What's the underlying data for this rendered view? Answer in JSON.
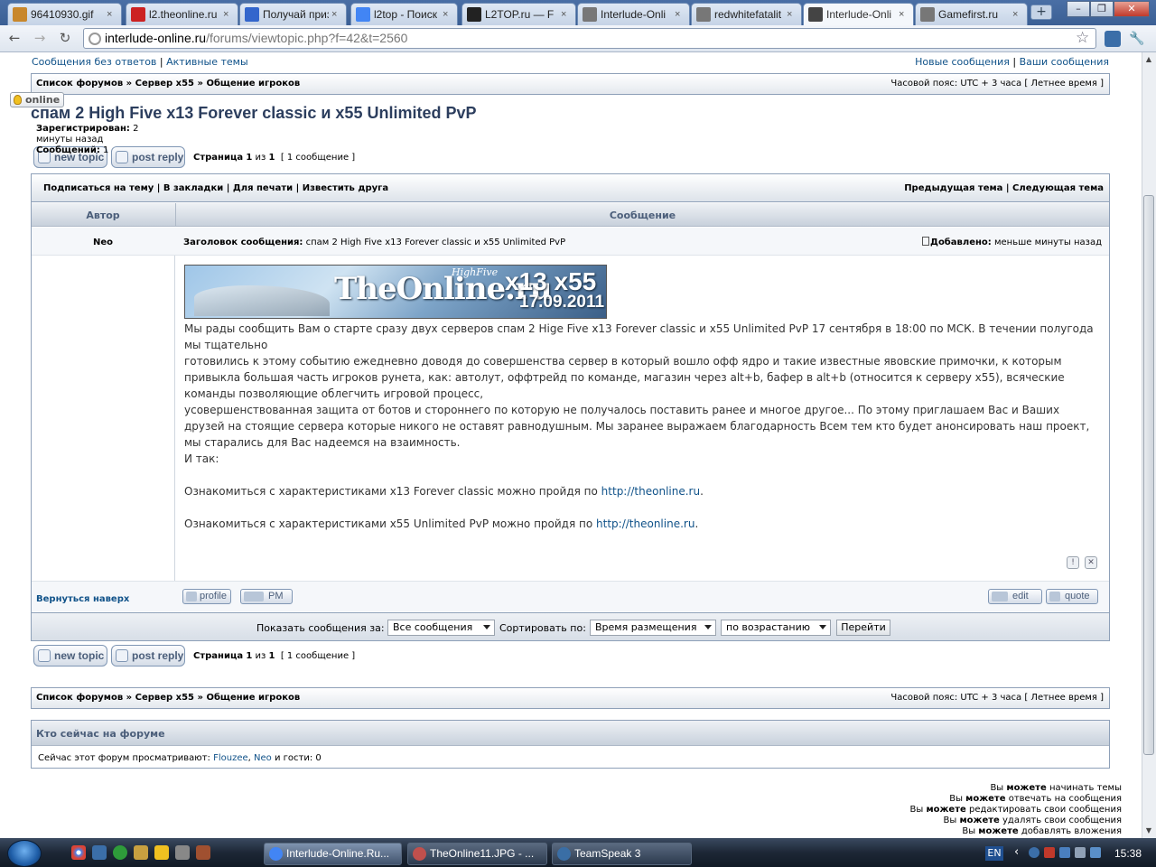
{
  "browser": {
    "tabs": [
      {
        "label": "96410930.gif",
        "icon_color": "#c8872c"
      },
      {
        "label": "l2.theonline.ru",
        "icon_color": "#cc2222"
      },
      {
        "label": "Получай приз",
        "icon_color": "#3366cc"
      },
      {
        "label": "l2top - Поиск",
        "icon_color": "#4285f4"
      },
      {
        "label": "L2TOP.ru — F",
        "icon_color": "#222222"
      },
      {
        "label": "Interlude-Onli",
        "icon_color": "#777777"
      },
      {
        "label": "redwhitefatalit",
        "icon_color": "#777777"
      },
      {
        "label": "Interlude-Onli",
        "icon_color": "#444444"
      },
      {
        "label": "Gamefirst.ru",
        "icon_color": "#777777"
      }
    ],
    "close_glyph": "×",
    "new_tab_glyph": "+",
    "window_buttons": [
      "–",
      "❐",
      "✕"
    ],
    "url_host": "interlude-online.ru",
    "url_path": "/forums/viewtopic.php?f=42&t=2560",
    "back_glyph": "←",
    "forward_glyph": "→",
    "reload_glyph": "↻",
    "star_glyph": "☆",
    "wrench_glyph": "🔧"
  },
  "forum": {
    "top_left_links": [
      "Сообщения без ответов",
      "|",
      "Активные темы"
    ],
    "top_right_links": [
      "Новые сообщения",
      "|",
      "Ваши сообщения"
    ],
    "breadcrumb": [
      "Список форумов",
      "»",
      "Сервер x55",
      "»",
      "Общение игроков"
    ],
    "timezone": "Часовой пояс: UTC + 3 часа [ Летнее время ]",
    "topic_title": "спам 2 High Five x13 Forever classic и x55 Unlimited PvP",
    "new_topic_label": "new topic",
    "post_reply_label": "post reply",
    "page_label_prefix": "Страница",
    "page_current": "1",
    "page_of": "из",
    "page_total": "1",
    "post_count_label": "[ 1 сообщение ]",
    "actions_left": "Подписаться на тему | В закладки | Для печати | Известить друга",
    "actions_right": "Предыдущая тема | Следующая тема",
    "col_author": "Автор",
    "col_message": "Сообщение",
    "post": {
      "author": "Neo",
      "subject_label": "Заголовок сообщения:",
      "subject": "спам 2 High Five x13 Forever classic и x55 Unlimited PvP",
      "added_label": "Добавлено:",
      "added_value": "меньше минуты назад",
      "online_label": "online",
      "registered_label": "Зарегистрирован:",
      "registered_value": "2 минуты назад",
      "posts_label": "Сообщений:",
      "posts_value": "1",
      "banner": {
        "site": "TheOnline.ru",
        "highfive": "HighFive",
        "rates": "x13 x55",
        "date": "17.09.2011"
      },
      "paragraphs": [
        "Мы рады сообщить Вам о старте сразу двух серверов спам 2 Hige Five x13 Forever classic и x55 Unlimited PvP 17 сентября в 18:00 по МСК. В течении полугода мы тщательно",
        "готовились к этому событию ежедневно доводя до совершенства сервер в который вошло офф ядро и такие известные явовские примочки, к которым привыкла большая часть игроков рунета, как: автолут, оффтрейд по команде, магазин через alt+b, бафер в alt+b (относится к серверу x55), всяческие команды позволяющие облегчить игровой процесс,",
        "усовершенствованная защита от ботов и стороннего по которую не получалось поставить ранее и многое другое... По этому приглашаем Вас и Ваших друзей на стоящие сервера которые никого не оставят равнодушным. Мы заранее выражаем благодарность Всем тем кто будет анонсировать наш проект, мы старались для Вас надеемся на взаимность.",
        "И так:"
      ],
      "link_line_1_prefix": "Ознакомиться с характеристиками x13 Forever classic можно пройдя по",
      "link_line_1_url": "http://theonline.ru",
      "link_line_2_prefix": "Ознакомиться с характеристиками x55 Unlimited PvP можно пройдя по",
      "link_line_2_url": "http://theonline.ru",
      "report_glyph": "!",
      "warn_glyph": "✕",
      "back_to_top": "Вернуться наверх",
      "profile_label": "profile",
      "pm_label": "PM",
      "edit_label": "edit",
      "quote_label": "quote"
    },
    "sort": {
      "show_label": "Показать сообщения за:",
      "show_value": "Все сообщения",
      "sort_label": "Сортировать по:",
      "sort_value": "Время размещения",
      "order_value": "по возрастанию",
      "go_label": "Перейти"
    },
    "who_online_title": "Кто сейчас на форуме",
    "who_online_prefix": "Сейчас этот форум просматривают:",
    "who_online_users": [
      "Flouzee",
      "Neo"
    ],
    "who_online_suffix": "и гости: 0",
    "permissions": [
      {
        "pre": "Вы",
        "bold": "можете",
        "post": "начинать темы"
      },
      {
        "pre": "Вы",
        "bold": "можете",
        "post": "отвечать на сообщения"
      },
      {
        "pre": "Вы",
        "bold": "можете",
        "post": "редактировать свои сообщения"
      },
      {
        "pre": "Вы",
        "bold": "можете",
        "post": "удалять свои сообщения"
      },
      {
        "pre": "Вы",
        "bold": "можете",
        "post": "добавлять вложения"
      }
    ]
  },
  "taskbar": {
    "tasks": [
      {
        "label": "Interlude-Online.Ru...",
        "icon_color": "#4285f4"
      },
      {
        "label": "TheOnline11.JPG - ...",
        "icon_color": "#c0504d"
      },
      {
        "label": "TeamSpeak 3",
        "icon_color": "#3a6ea5"
      }
    ],
    "lang": "EN",
    "clock": "15:38",
    "tray_arrow": "‹"
  },
  "colors": {
    "link": "#105289",
    "title": "#2c3e5e",
    "border": "#8ea0b8"
  }
}
